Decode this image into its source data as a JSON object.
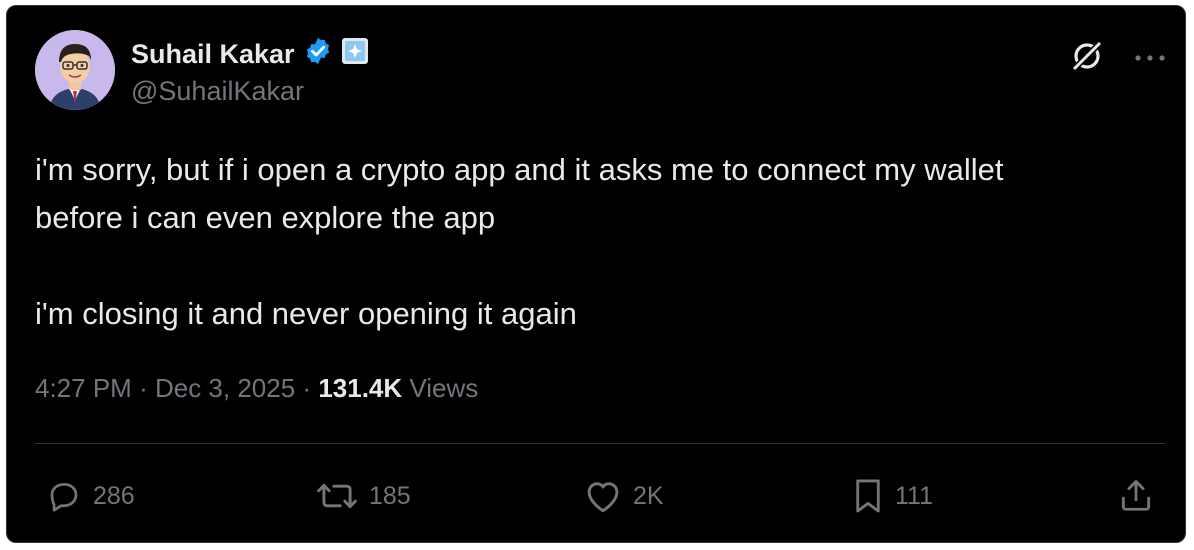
{
  "tweet": {
    "author": {
      "display_name": "Suhail Kakar",
      "handle": "@SuhailKakar",
      "verified_icon": "verified-badge-icon",
      "affiliate_icon": "affiliate-badge-icon",
      "avatar": "cartoon-avatar-glasses"
    },
    "text": {
      "line1": "i'm sorry, but if i open a crypto app and it asks me to connect my wallet",
      "line2": "before i can even explore the app",
      "line3": "i'm closing it and never opening it again"
    },
    "meta": {
      "time": "4:27 PM",
      "separator": "·",
      "date": "Dec 3, 2025",
      "views_count": "131.4K",
      "views_label": "Views"
    },
    "actions": {
      "replies": "286",
      "reposts": "185",
      "likes": "2K",
      "bookmarks": "111"
    }
  },
  "colors": {
    "background": "#000000",
    "text_primary": "#e7e9ea",
    "text_secondary": "#71767b",
    "verified": "#1d9bf0",
    "divider": "#2f3336"
  }
}
